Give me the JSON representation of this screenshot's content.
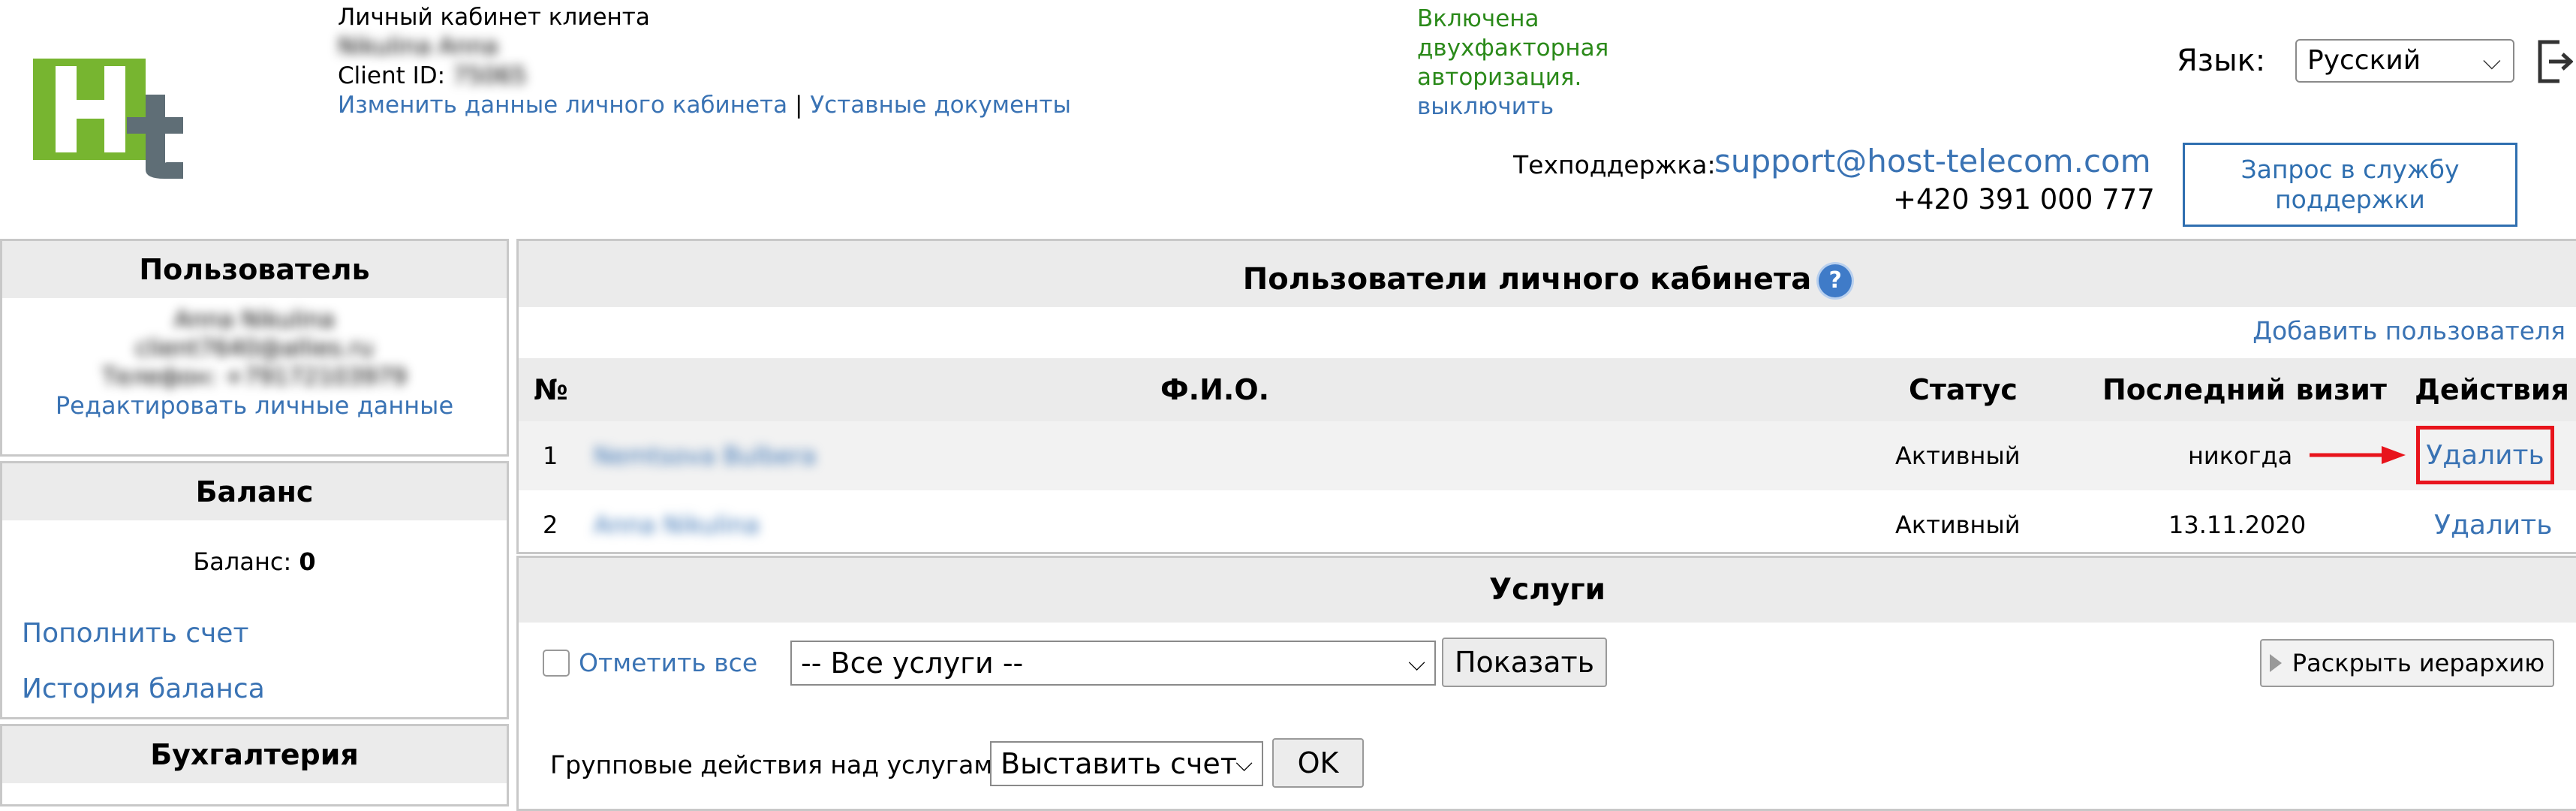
{
  "header": {
    "cabinet_title": "Личный кабинет клиента",
    "client_name": "Nikulina Anna",
    "client_id_label": "Client ID:",
    "client_id_value": "75065",
    "edit_cabinet_link": "Изменить данные личного кабинета",
    "separator": "|",
    "statutory_docs_link": "Уставные документы",
    "twofa_line1": "Включена",
    "twofa_line2": "двухфакторная",
    "twofa_line3": "авторизация.",
    "twofa_disable": "выключить",
    "language_label": "Язык:",
    "language_value": "Русский",
    "support_label": "Техподдержка:",
    "support_email": "support@host-telecom.com",
    "support_phone": "+420 391 000 777",
    "support_button_line1": "Запрос в службу",
    "support_button_line2": "поддержки",
    "logo_letters": "Ht"
  },
  "sidebar": {
    "user_title": "Пользователь",
    "user_name": "Anna Nikulina",
    "user_email": "client7640@allies.ru",
    "user_phone": "Телефон: +79172103979",
    "edit_personal": "Редактировать личные данные",
    "balance_title": "Баланс",
    "balance_label": "Баланс:",
    "balance_value": "0",
    "top_up": "Пополнить счет",
    "balance_history": "История баланса",
    "accounting_title": "Бухгалтерия"
  },
  "users": {
    "title": "Пользователи личного кабинета",
    "help_icon": "?",
    "add_user": "Добавить пользователя",
    "columns": {
      "num": "№",
      "name": "Ф.И.О.",
      "status": "Статус",
      "last_visit": "Последний визит",
      "actions": "Действия"
    },
    "rows": [
      {
        "num": "1",
        "name": "Nemtsova Bulbera",
        "status": "Активный",
        "last_visit": "никогда",
        "action": "Удалить"
      },
      {
        "num": "2",
        "name": "Anna Nikulina",
        "status": "Активный",
        "last_visit": "13.11.2020",
        "action": "Удалить"
      }
    ]
  },
  "services": {
    "title": "Услуги",
    "select_all": "Отметить все",
    "filter_value": "-- Все услуги --",
    "show_button": "Показать",
    "expand_button": "Раскрыть иерархию",
    "group_label": "Групповые действия над услугами",
    "group_value": "Выставить счет",
    "ok_button": "OK"
  },
  "colors": {
    "link": "#3a73b4",
    "twofa_green": "#2b8a1a",
    "annotation_red": "#e8141c",
    "panel_header": "#ebebeb",
    "logo_green": "#77b530",
    "logo_gray": "#5f6e76"
  },
  "icons": {
    "logout": "logout-icon",
    "help": "help-icon",
    "expand": "play-icon",
    "dropdown": "chevron-down-icon"
  }
}
